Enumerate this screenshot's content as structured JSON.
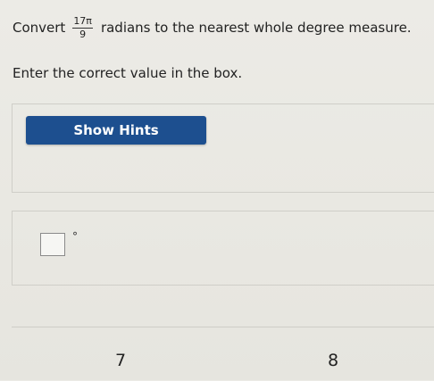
{
  "question": {
    "prefix": "Convert",
    "fraction": {
      "numerator": "17π",
      "denominator": "9"
    },
    "suffix": "radians to the nearest whole degree measure."
  },
  "instruction": "Enter the correct value in the box.",
  "hints": {
    "button_label": "Show Hints"
  },
  "answer": {
    "value": "",
    "unit": "°"
  },
  "keypad": {
    "keys": [
      "7",
      "8"
    ]
  }
}
